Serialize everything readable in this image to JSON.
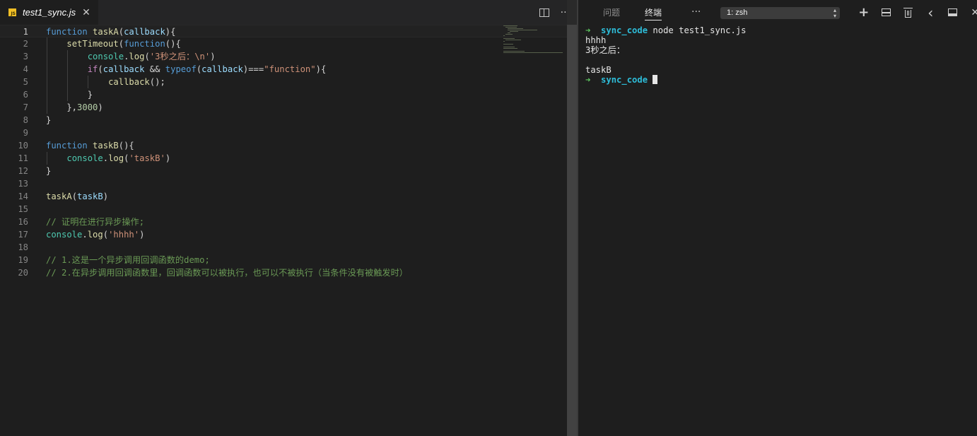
{
  "editor": {
    "tab": {
      "title": "test1_sync.js",
      "badge": "JS",
      "close": "✕"
    },
    "actions": {
      "more": "···"
    },
    "lines": [
      {
        "n": "1"
      },
      {
        "n": "2"
      },
      {
        "n": "3"
      },
      {
        "n": "4"
      },
      {
        "n": "5"
      },
      {
        "n": "6"
      },
      {
        "n": "7"
      },
      {
        "n": "8"
      },
      {
        "n": "9"
      },
      {
        "n": "10"
      },
      {
        "n": "11"
      },
      {
        "n": "12"
      },
      {
        "n": "13"
      },
      {
        "n": "14"
      },
      {
        "n": "15"
      },
      {
        "n": "16"
      },
      {
        "n": "17"
      },
      {
        "n": "18"
      },
      {
        "n": "19"
      },
      {
        "n": "20"
      }
    ],
    "code": {
      "l1": [
        "function",
        " ",
        "taskA",
        "(",
        "callback",
        "){"
      ],
      "l2": [
        "    ",
        "setTimeout",
        "(",
        "function",
        "(){"
      ],
      "l3": [
        "        ",
        "console",
        ".",
        "log",
        "(",
        "'3秒之后：\\n'",
        ")"
      ],
      "l4": [
        "        ",
        "if",
        "(",
        "callback",
        " && ",
        "typeof",
        "(",
        "callback",
        ")===",
        "\"function\"",
        "){"
      ],
      "l5": [
        "            ",
        "callback",
        "();"
      ],
      "l6": [
        "        }"
      ],
      "l7": [
        "    },",
        "3000",
        ")"
      ],
      "l8": [
        "}"
      ],
      "l10": [
        "function",
        " ",
        "taskB",
        "(){"
      ],
      "l11": [
        "    ",
        "console",
        ".",
        "log",
        "(",
        "'taskB'",
        ")"
      ],
      "l12": [
        "}"
      ],
      "l14": [
        "taskA",
        "(",
        "taskB",
        ")"
      ],
      "l16": [
        "// 证明在进行异步操作;"
      ],
      "l17": [
        "console",
        ".",
        "log",
        "(",
        "'hhhh'",
        ")"
      ],
      "l19": [
        "// 1.这是一个异步调用回调函数的demo;"
      ],
      "l20": [
        "// 2.在异步调用回调函数里，回调函数可以被执行，也可以不被执行（当条件没有被触发时）"
      ]
    },
    "colors": {
      "keyword": "#569cd6",
      "function": "#dcdcaa",
      "variable": "#9cdcfe",
      "string": "#ce9178",
      "number": "#b5cea8",
      "comment": "#6a9955",
      "object": "#4ec9b0",
      "control": "#c586c0"
    }
  },
  "panel": {
    "tabs": [
      {
        "label": "问题",
        "active": false
      },
      {
        "label": "终端",
        "active": true
      }
    ],
    "more": "···",
    "terminal_select": "1: zsh",
    "select_arrows": "▲▼",
    "actions": {
      "add": "+",
      "back": "‹",
      "close": "✕"
    },
    "terminal": {
      "prompt_arrow": "➜",
      "prompt_dir": "sync_code",
      "command": "node test1_sync.js",
      "output": [
        "hhhh",
        "3秒之后：",
        "",
        "taskB"
      ]
    }
  }
}
